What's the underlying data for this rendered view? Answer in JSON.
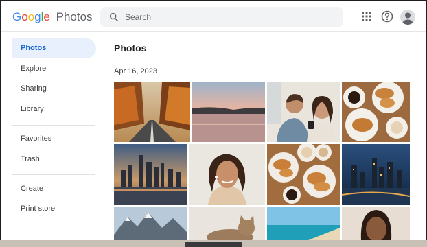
{
  "app": {
    "logo_google": "Google",
    "logo_product": "Photos"
  },
  "search": {
    "placeholder": "Search"
  },
  "header": {
    "apps_icon": "apps-grid-icon",
    "help_icon": "help-icon",
    "avatar_icon": "account-avatar"
  },
  "sidebar": {
    "items": [
      {
        "label": "Photos",
        "active": true
      },
      {
        "label": "Explore"
      },
      {
        "label": "Sharing"
      },
      {
        "label": "Library"
      },
      {
        "label": "Favorites"
      },
      {
        "label": "Trash"
      },
      {
        "label": "Create"
      },
      {
        "label": "Print store"
      }
    ]
  },
  "main": {
    "title": "Photos",
    "date_group": "Apr 16, 2023"
  },
  "colors": {
    "accent": "#1967d2",
    "active_bg": "#e8f0fe",
    "search_bg": "#f1f3f4"
  }
}
